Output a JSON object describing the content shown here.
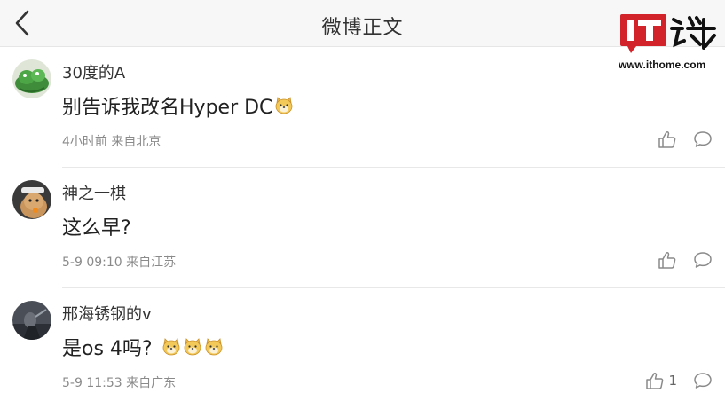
{
  "header": {
    "title": "微博正文"
  },
  "watermark": {
    "url": "www.ithome.com"
  },
  "comments": [
    {
      "username": "30度的A",
      "text": "别告诉我改名Hyper DC",
      "emojis": [
        "doge"
      ],
      "meta": "4小时前 来自北京",
      "like_count": ""
    },
    {
      "username": "神之一棋",
      "text": "这么早?",
      "emojis": [],
      "meta": "5-9 09:10 来自江苏",
      "like_count": ""
    },
    {
      "username": "邢海锈钢的v",
      "text": "是os 4吗?",
      "emojis": [
        "doge",
        "doge",
        "doge"
      ],
      "meta": "5-9 11:53 来自广东",
      "like_count": "1"
    }
  ],
  "icons": {
    "back": "chevron-left-icon",
    "like": "thumbs-up-icon",
    "reply": "speech-bubble-icon",
    "emoji": "doge-emoji"
  },
  "colors": {
    "header_bg": "#f7f7f7",
    "meta_text": "#8a8a8a",
    "logo_red": "#d2232a",
    "emoji_yellow": "#f3c95a"
  }
}
